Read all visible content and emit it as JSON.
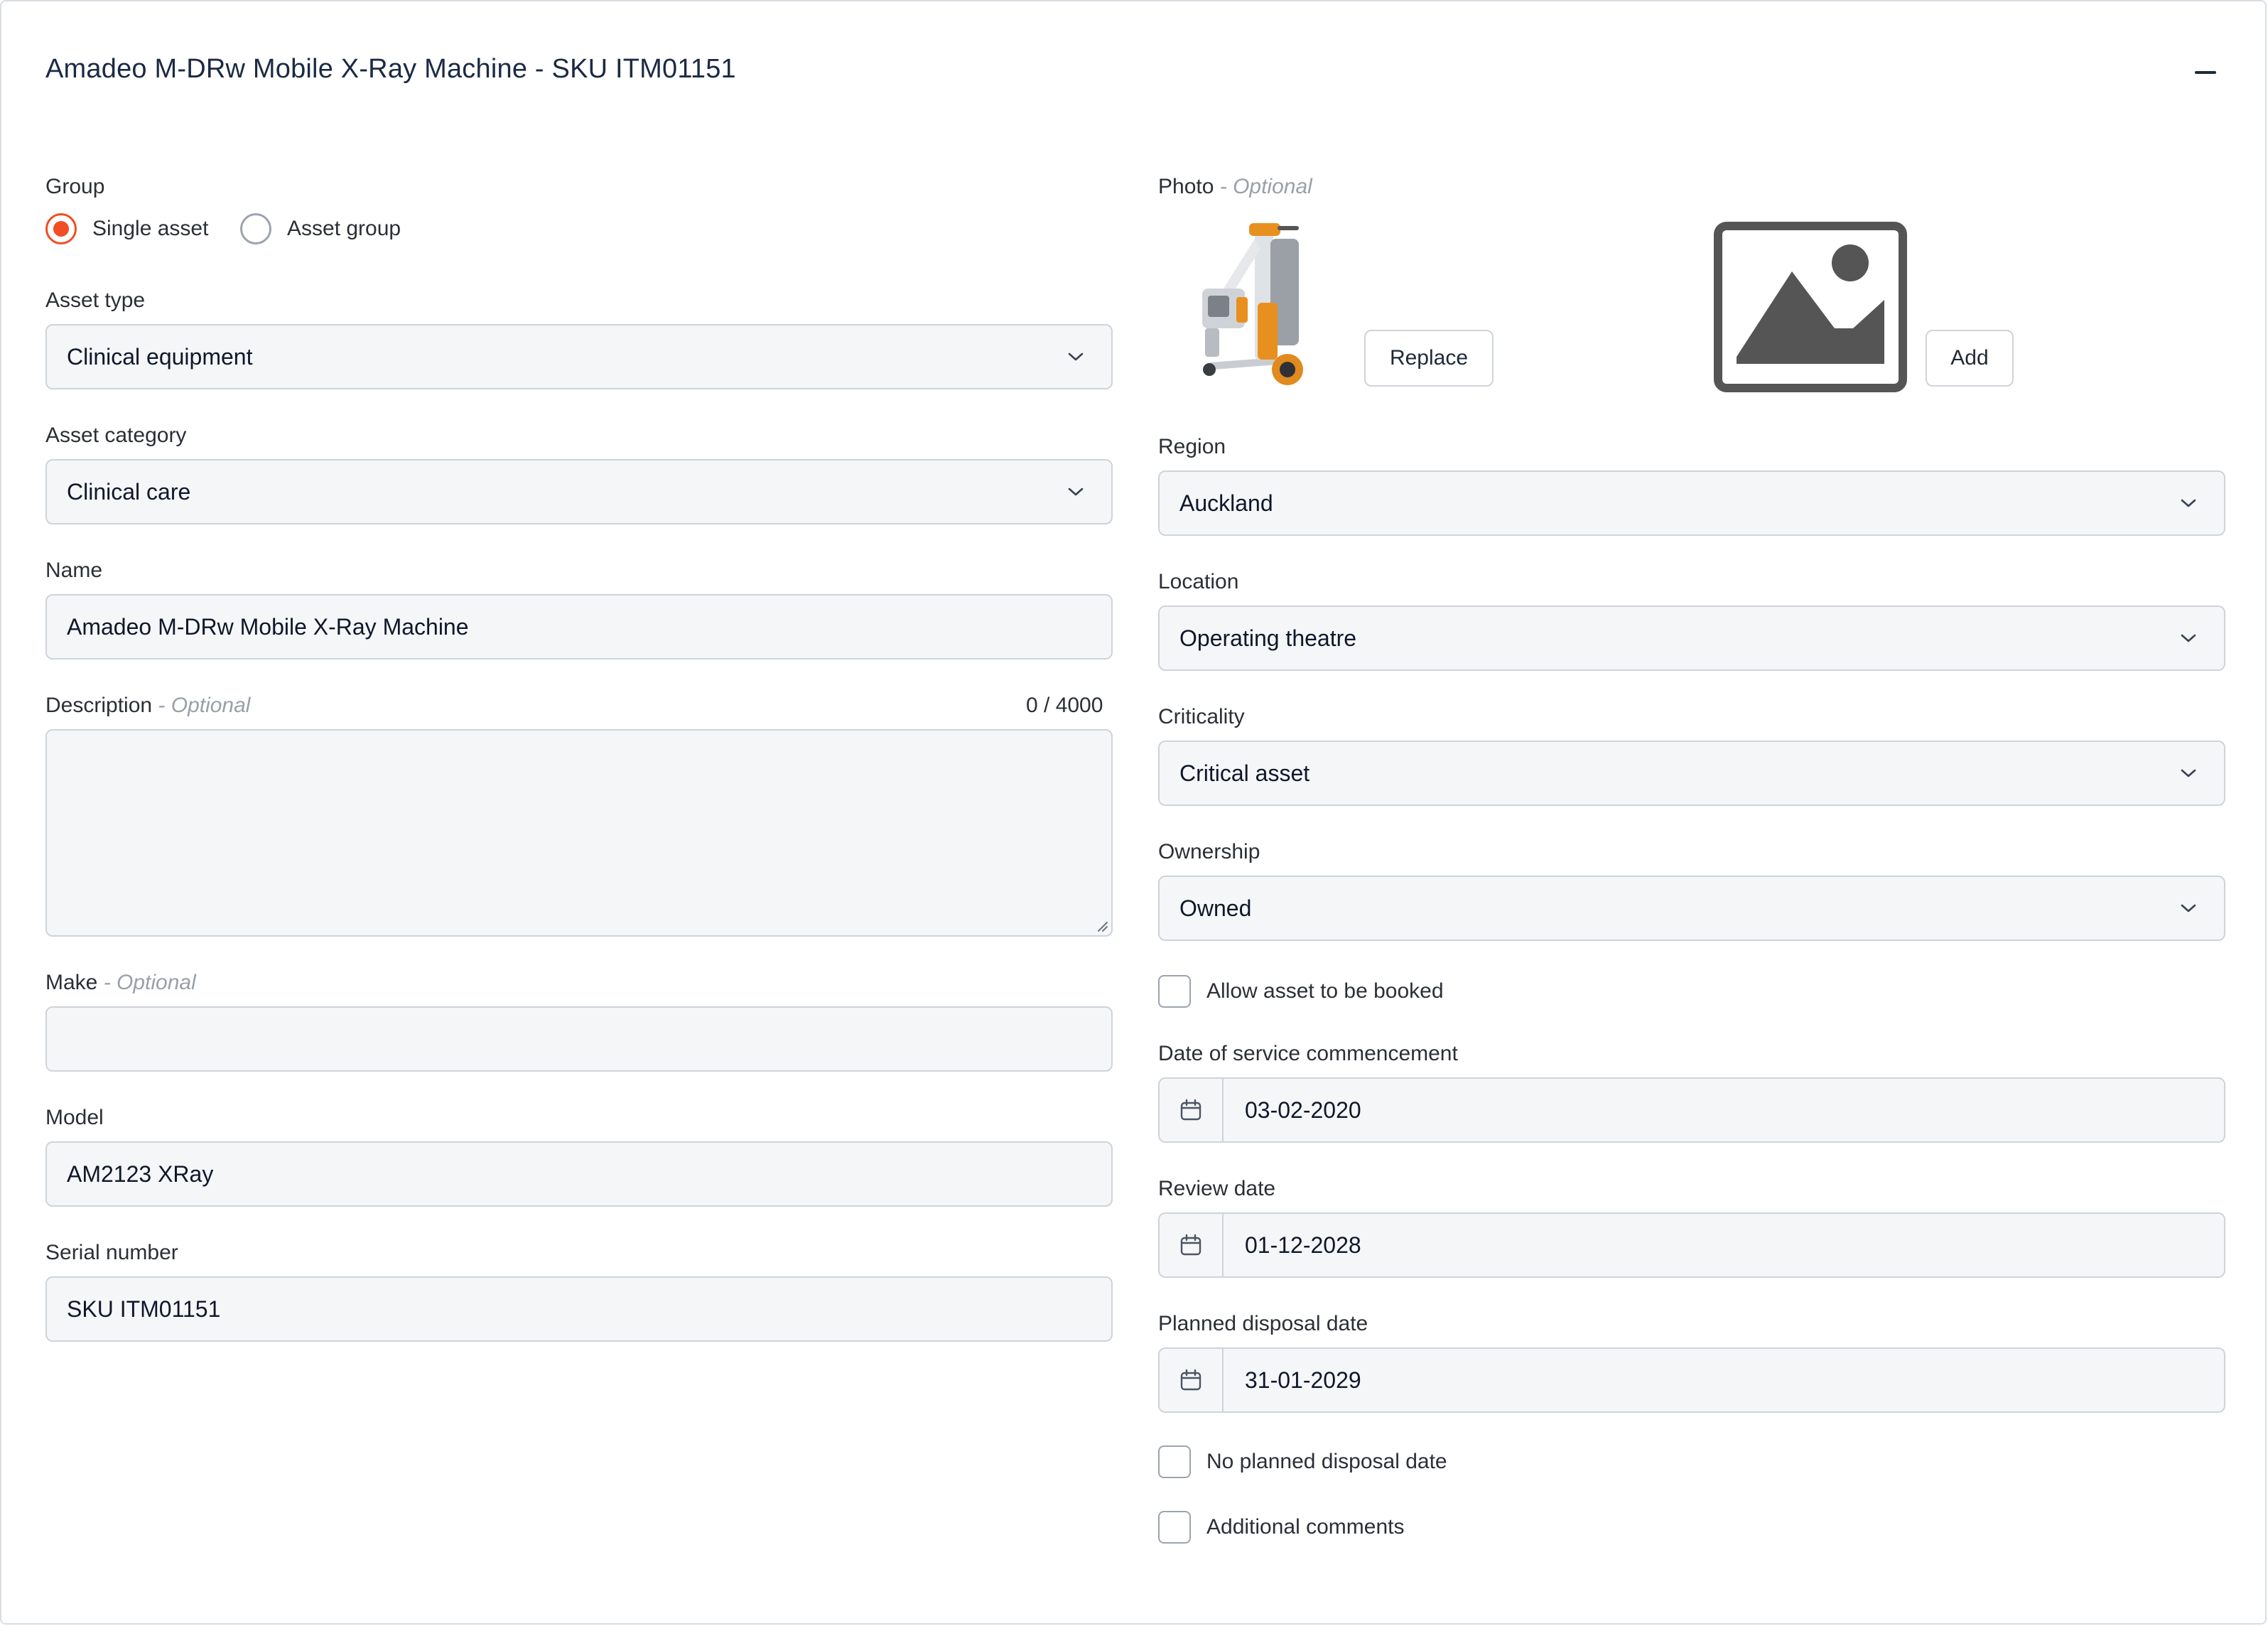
{
  "header": {
    "title": "Amadeo M-DRw Mobile X-Ray Machine - SKU ITM01151"
  },
  "group": {
    "label": "Group",
    "options": [
      {
        "label": "Single asset",
        "selected": true
      },
      {
        "label": "Asset group",
        "selected": false
      }
    ]
  },
  "asset_type": {
    "label": "Asset type",
    "value": "Clinical equipment"
  },
  "asset_category": {
    "label": "Asset category",
    "value": "Clinical care"
  },
  "name": {
    "label": "Name",
    "value": "Amadeo M-DRw Mobile X-Ray Machine"
  },
  "description": {
    "label": "Description",
    "optional": "- Optional",
    "counter": "0 / 4000",
    "value": ""
  },
  "make": {
    "label": "Make",
    "optional": "- Optional",
    "value": ""
  },
  "model": {
    "label": "Model",
    "value": "AM2123 XRay"
  },
  "serial_number": {
    "label": "Serial number",
    "value": "SKU ITM01151"
  },
  "photo": {
    "label": "Photo",
    "optional": "- Optional",
    "replace_label": "Replace",
    "add_label": "Add"
  },
  "region": {
    "label": "Region",
    "value": "Auckland"
  },
  "location": {
    "label": "Location",
    "value": "Operating theatre"
  },
  "criticality": {
    "label": "Criticality",
    "value": "Critical asset"
  },
  "ownership": {
    "label": "Ownership",
    "value": "Owned"
  },
  "allow_booking": {
    "label": "Allow asset to be booked",
    "checked": false
  },
  "service_commencement": {
    "label": "Date of service commencement",
    "value": "03-02-2020"
  },
  "review_date": {
    "label": "Review date",
    "value": "01-12-2028"
  },
  "planned_disposal": {
    "label": "Planned disposal date",
    "value": "31-01-2029"
  },
  "no_planned_disposal": {
    "label": "No planned disposal date",
    "checked": false
  },
  "additional_comments": {
    "label": "Additional comments",
    "checked": false
  },
  "colors": {
    "accent": "#f04e23",
    "title": "#1b2a44",
    "field_bg": "#f5f6f8",
    "border": "#cfd4da"
  }
}
